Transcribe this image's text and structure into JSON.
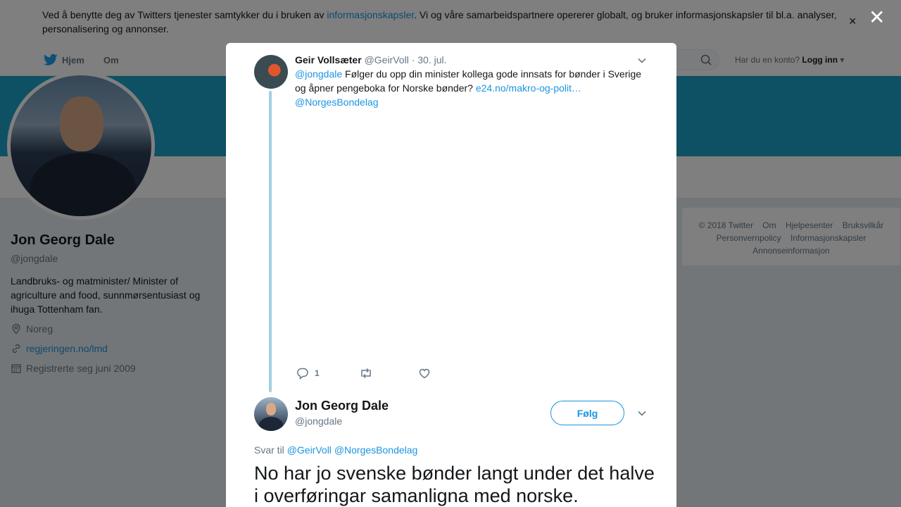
{
  "cookie_banner": {
    "text_before": "Ved å benytte deg av Twitters tjenester samtykker du i bruken av ",
    "link": "informasjonskapsler",
    "text_after": ". Vi og våre samarbeidspartnere opererer globalt, og bruker informasjonskapsler til bl.a. analyser, personalisering og annonser.",
    "close": "×"
  },
  "nav": {
    "home": "Hjem",
    "about": "Om",
    "account_prompt": "Har du en konto?",
    "login": "Logg inn"
  },
  "profile": {
    "name": "Jon Georg Dale",
    "handle": "@jongdale",
    "bio": "Landbruks- og matminister/ Minister of agriculture and food, sunnmørsentusiast og ihuga Tottenham fan.",
    "location": "Noreg",
    "website": "regjeringen.no/lmd",
    "joined": "Registrerte seg juni 2009"
  },
  "footer": {
    "links": [
      "© 2018 Twitter",
      "Om",
      "Hjelpesenter",
      "Bruksvilkår",
      "Personvernpolicy",
      "Informasjonskapsler",
      "Annonseinformasjon"
    ]
  },
  "overlay": {
    "close": "✕"
  },
  "parent_tweet": {
    "name": "Geir Vollsæter",
    "handle": "@GeirVoll",
    "date": "· 30. jul.",
    "mention": "@jongdale",
    "text": " Følger du opp din minister kollega gode innsats for bønder i Sverige og åpner pengeboka for Norske bønder? ",
    "link": "e24.no/makro-og-polit…",
    "mention2": "@NorgesBondelag",
    "reply_count": "1",
    "retweet_count": "",
    "like_count": ""
  },
  "main_tweet": {
    "name": "Jon Georg Dale",
    "handle": "@jongdale",
    "follow": "Følg",
    "reply_prefix": "Svar til",
    "reply_mention1": "@GeirVoll",
    "reply_mention2": "@NorgesBondelag",
    "text": "No har jo svenske bønder langt under det halve i overføringar samanligna med norske."
  },
  "colors": {
    "accent": "#1b95e0",
    "banner": "#1da1c8",
    "thread": "#a4d0e0"
  }
}
